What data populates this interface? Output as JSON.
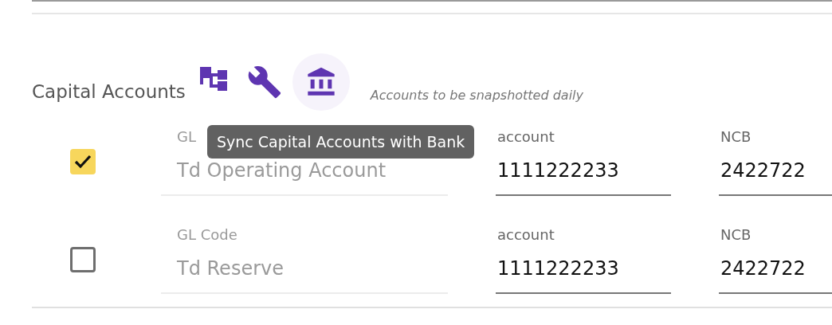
{
  "section": {
    "title": "Capital Accounts",
    "note": "Accounts to be snapshotted daily",
    "tools": [
      {
        "kind": "hierarchy",
        "hovered": false
      },
      {
        "kind": "wrench",
        "hovered": false
      },
      {
        "kind": "bank",
        "hovered": true
      }
    ],
    "tooltip": "Sync Capital Accounts with Bank"
  },
  "rows": [
    {
      "checked": true,
      "fields": [
        {
          "kind": "disabled",
          "label": "GL",
          "value": "Td Operating Account"
        },
        {
          "kind": "input",
          "label": "account",
          "value": "1111222233"
        },
        {
          "kind": "input",
          "label": "NCB",
          "value": "2422722"
        }
      ]
    },
    {
      "checked": false,
      "fields": [
        {
          "kind": "disabled",
          "label": "GL Code",
          "value": "Td Reserve"
        },
        {
          "kind": "input",
          "label": "account",
          "value": "1111222233"
        },
        {
          "kind": "input",
          "label": "NCB",
          "value": "2422722"
        }
      ]
    }
  ]
}
